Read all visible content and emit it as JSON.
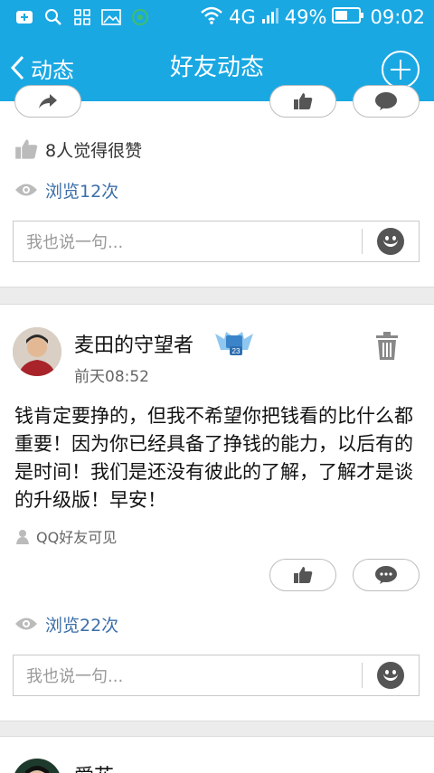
{
  "status_bar": {
    "network": "4G",
    "battery": "49%",
    "time": "09:02"
  },
  "nav": {
    "back_label": "动态",
    "title": "好友动态"
  },
  "post1": {
    "likes_text": "8人觉得很赞",
    "views_text": "浏览12次",
    "comment_placeholder": "我也说一句..."
  },
  "post2": {
    "author": "麦田的守望者",
    "time": "前天08:52",
    "content": "钱肯定要挣的，但我不希望你把钱看的比什么都重要！因为你已经具备了挣钱的能力，以后有的是时间！我们是还没有彼此的了解，了解才是谈的升级版！早安！",
    "visibility": "QQ好友可见",
    "views_text": "浏览22次",
    "comment_placeholder": "我也说一句...",
    "badge_number": "23"
  },
  "post3": {
    "author": "爱花"
  }
}
